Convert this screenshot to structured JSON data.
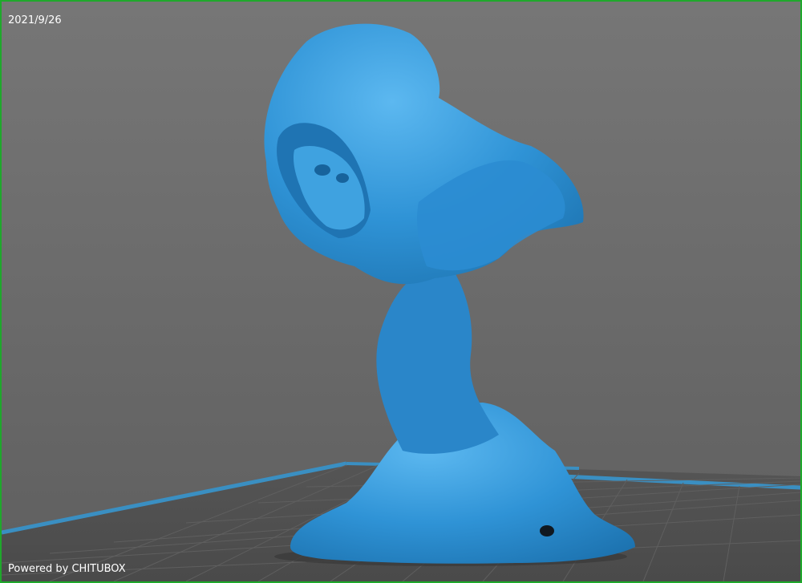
{
  "viewport": {
    "date": "2021/9/26",
    "powered_by": "Powered by CHITUBOX"
  },
  "colors": {
    "background": "#6b6b6b",
    "frame": "#1fa82c",
    "model": "#2f93d6",
    "platform_edge": "#3a8fc2",
    "grid": "#5a5a5a"
  },
  "icons": {
    "model": "hooded-skull-bust-model"
  }
}
